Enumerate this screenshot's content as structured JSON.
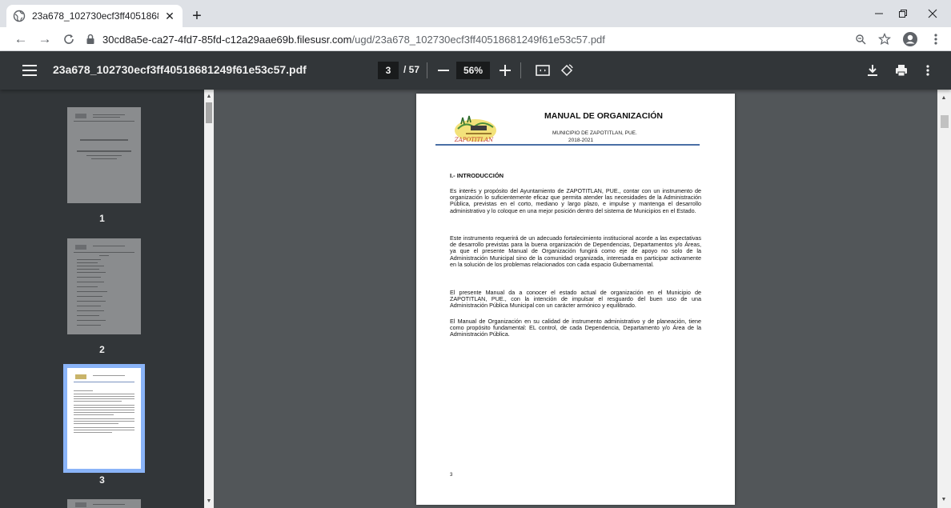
{
  "browser": {
    "tab_title": "23a678_102730ecf3ff405186812\u0000",
    "url_host": "30cd8a5e-ca27-4fd7-85fd-c12a29aae69b.filesusr.com",
    "url_path": "/ugd/23a678_102730ecf3ff40518681249f61e53c57.pdf"
  },
  "viewer": {
    "filename": "23a678_102730ecf3ff40518681249f61e53c57.pdf",
    "current_page": "3",
    "total_pages": "/ 57",
    "zoom": "56%"
  },
  "thumbnails": [
    {
      "label": "1"
    },
    {
      "label": "2"
    },
    {
      "label": "3"
    }
  ],
  "document": {
    "header_title": "MANUAL DE ORGANIZACIÓN",
    "header_municipality": "MUNICIPIO DE ZAPOTITLAN, PUE.",
    "header_years": "2018-2021",
    "logo_text": "ZAPOTITLAN",
    "section_title": "I.- INTRODUCCIÓN",
    "paragraphs": [
      "Es interés y propósito del Ayuntamiento de ZAPOTITLAN, PUE., contar con un instrumento de organización lo suficientemente eficaz que permita atender las necesidades de la Administración Pública, previstas en el corto, mediano y largo plazo, e impulse y mantenga el desarrollo administrativo y lo coloque en una mejor posición dentro del sistema de Municipios en el Estado.",
      "Este instrumento requerirá de un adecuado fortalecimiento institucional acorde a las expectativas de desarrollo previstas para la buena organización de Dependencias, Departamentos y/o Áreas, ya que el presente Manual de Organización fungirá como eje de apoyo no solo de la Administración Municipal sino de la comunidad organizada, interesada en participar activamente en la solución de los problemas relacionados con cada espacio Gubernamental.",
      "El presente Manual da a conocer el estado actual de organización en el Municipio de ZAPOTITLAN, PUE., con la intención de impulsar el resguardo del buen uso de una Administración Pública Municipal con un carácter armónico y equilibrado.",
      "El Manual de Organización en su calidad de instrumento administrativo y de planeación, tiene como propósito fundamental: EL control, de cada Dependencia, Departamento y/o Área de la Administración Pública."
    ],
    "page_number": "3"
  },
  "colors": {
    "tabstrip": "#dee1e6",
    "pdf_toolbar": "#323639",
    "viewer_bg": "#525659",
    "thumb_selected": "#8ab4f8",
    "header_rule": "#4a6fa5"
  }
}
